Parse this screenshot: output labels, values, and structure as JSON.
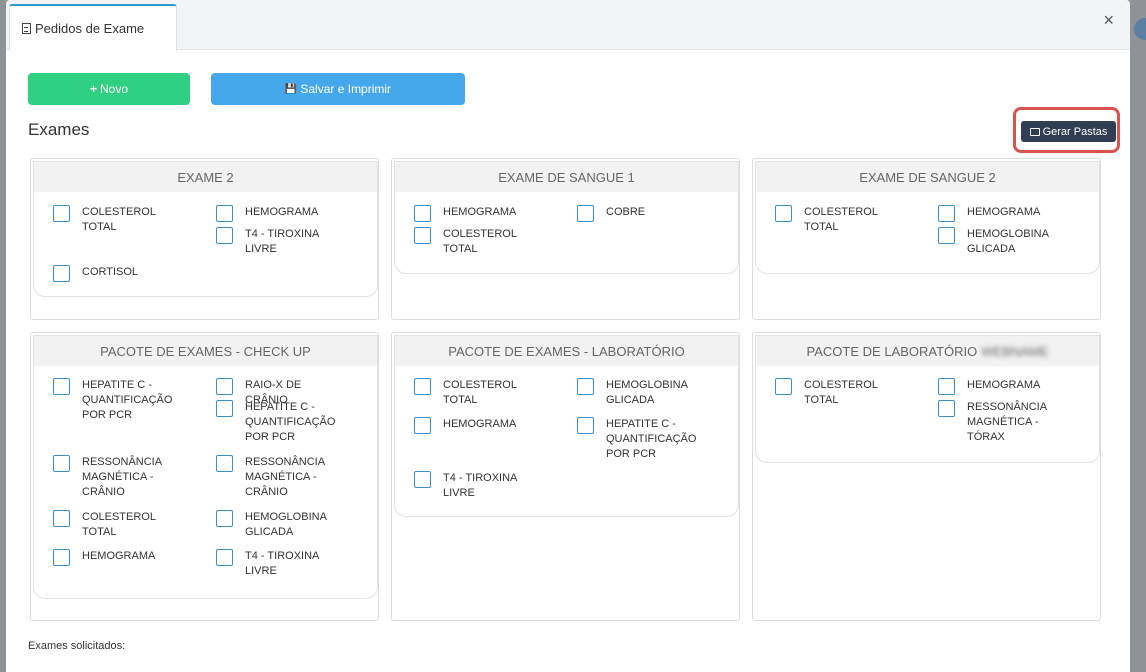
{
  "tab": {
    "label": "Pedidos de Exame"
  },
  "close_symbol": "×",
  "buttons": {
    "novo_icon": "+",
    "novo": "Novo",
    "salvar_icon": "💾",
    "salvar": "Salvar e Imprimir",
    "gerar_pastas": "Gerar Pastas"
  },
  "section_title": "Exames",
  "groups": [
    {
      "title": "EXAME 2",
      "items": [
        "COLESTEROL TOTAL",
        "HEMOGRAMA",
        "T4 - TIROXINA LIVRE",
        "CORTISOL"
      ]
    },
    {
      "title": "EXAME DE SANGUE 1",
      "items": [
        "HEMOGRAMA",
        "COBRE",
        "COLESTEROL TOTAL"
      ]
    },
    {
      "title": "EXAME DE SANGUE 2",
      "items": [
        "COLESTEROL TOTAL",
        "HEMOGRAMA",
        "HEMOGLOBINA GLICADA"
      ]
    },
    {
      "title": "PACOTE DE EXAMES - CHECK UP",
      "items": [
        "HEPATITE C - QUANTIFICAÇÃO POR PCR",
        "RAIO-X DE CRÂNIO",
        "HEPATITE C - QUANTIFICAÇÃO POR PCR",
        "RESSONÂNCIA MAGNÉTICA - CRÂNIO",
        "RESSONÂNCIA MAGNÉTICA - CRÂNIO",
        "COLESTEROL TOTAL",
        "HEMOGLOBINA GLICADA",
        "HEMOGRAMA",
        "T4 - TIROXINA LIVRE"
      ]
    },
    {
      "title": "PACOTE DE EXAMES - LABORATÓRIO",
      "items": [
        "COLESTEROL TOTAL",
        "HEMOGLOBINA GLICADA",
        "HEMOGRAMA",
        "HEPATITE C - QUANTIFICAÇÃO POR PCR",
        "T4 - TIROXINA LIVRE"
      ]
    },
    {
      "title": "PACOTE DE LABORATÓRIO",
      "title_redacted": "WEBNAME",
      "items": [
        "COLESTEROL TOTAL",
        "HEMOGRAMA",
        "RESSONÂNCIA MAGNÉTICA - TÓRAX"
      ]
    }
  ],
  "footer_label": "Exames solicitados:"
}
